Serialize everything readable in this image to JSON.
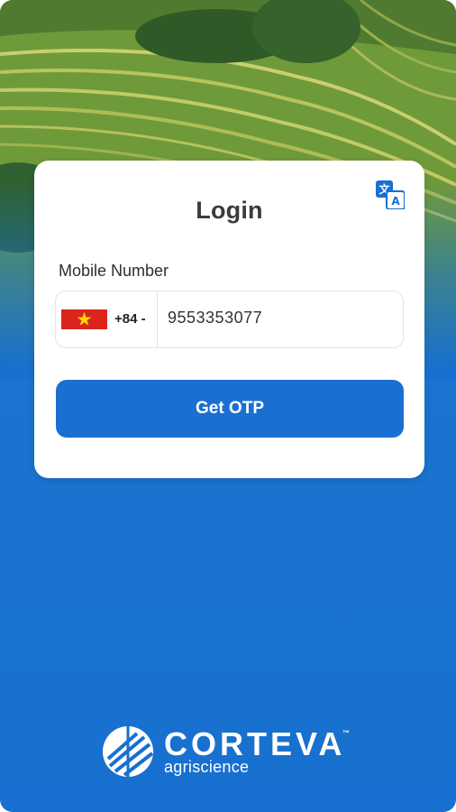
{
  "login": {
    "title": "Login",
    "mobile_label": "Mobile Number",
    "country_code": "+84 -",
    "phone_value": "9553353077",
    "get_otp_label": "Get OTP",
    "language_icon": "translate-icon",
    "flag": "vietnam-flag"
  },
  "brand": {
    "name": "CORTEVA",
    "trademark": "™",
    "tagline": "agriscience"
  },
  "colors": {
    "primary": "#1a6fd1",
    "background_blue": "#1770cf",
    "flag_red": "#da251d",
    "flag_star": "#ffde00"
  }
}
